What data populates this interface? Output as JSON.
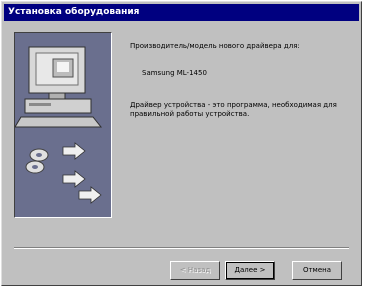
{
  "window": {
    "title": "Установка оборудования"
  },
  "content": {
    "intro": "Производитель/модель нового драйвера для:",
    "device_name": "Samsung ML-1450",
    "description": "Драйвер устройства - это программа, необходимая для правильной работы устройства."
  },
  "buttons": {
    "back": "< Назад",
    "next": "Далее >",
    "cancel": "Отмена"
  },
  "colors": {
    "titlebar": "#000080",
    "dialog": "#c0c0c0",
    "illustration": "#6a6f8e"
  }
}
